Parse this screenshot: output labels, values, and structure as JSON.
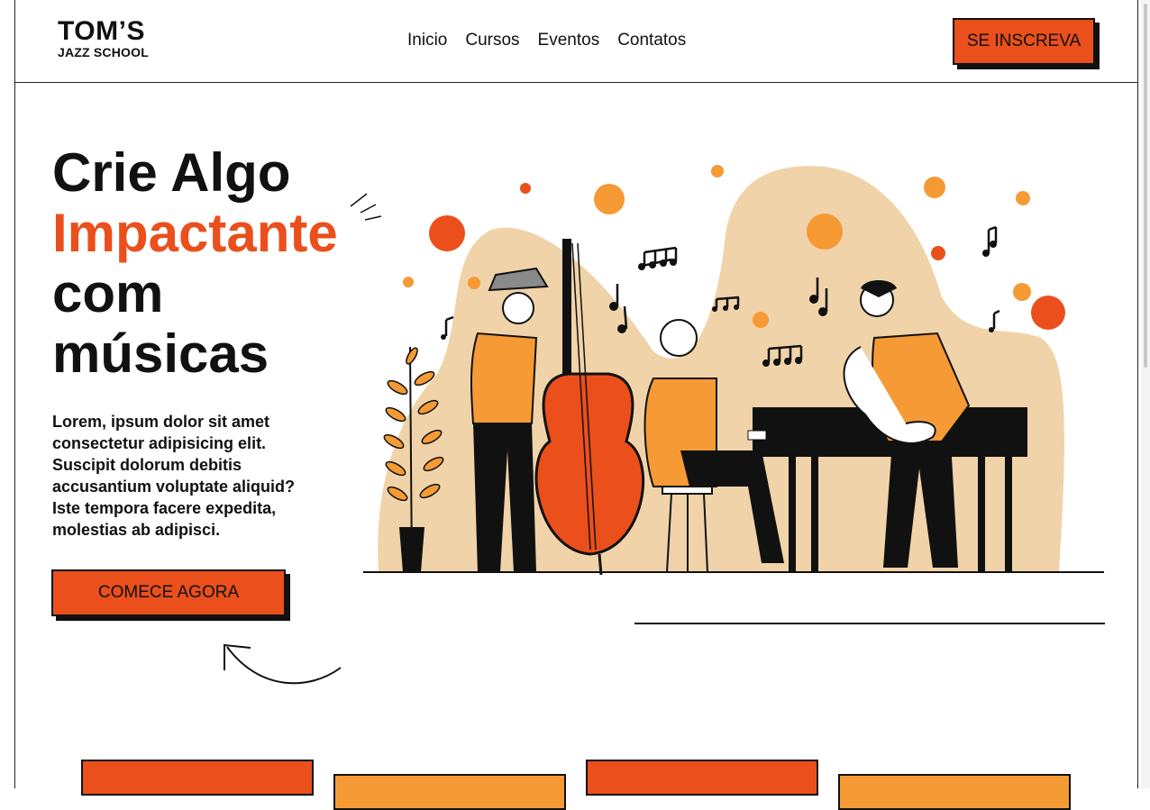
{
  "brand": {
    "name": "TOM’S",
    "tagline": "JAZZ SCHOOL"
  },
  "nav": {
    "items": [
      "Inicio",
      "Cursos",
      "Eventos",
      "Contatos"
    ],
    "signup_label": "SE INSCREVA"
  },
  "hero": {
    "title_line1": "Crie Algo",
    "title_line2": "Impactante",
    "title_line3": "com",
    "title_line4": "músicas",
    "body": "Lorem, ipsum dolor sit amet consectetur adipisicing elit. Suscipit dolorum debitis accusantium voluptate aliquid? Iste tempora facere expedita, molestias ab adipisci.",
    "cta_label": "COMECE AGORA"
  },
  "colors": {
    "accent": "#ea4f1c",
    "secondary": "#f59a35",
    "blob": "#f0d3a8",
    "ink": "#111111"
  },
  "icons": [
    "sketch-lines-icon",
    "curved-arrow-icon",
    "jazz-band-illustration"
  ]
}
